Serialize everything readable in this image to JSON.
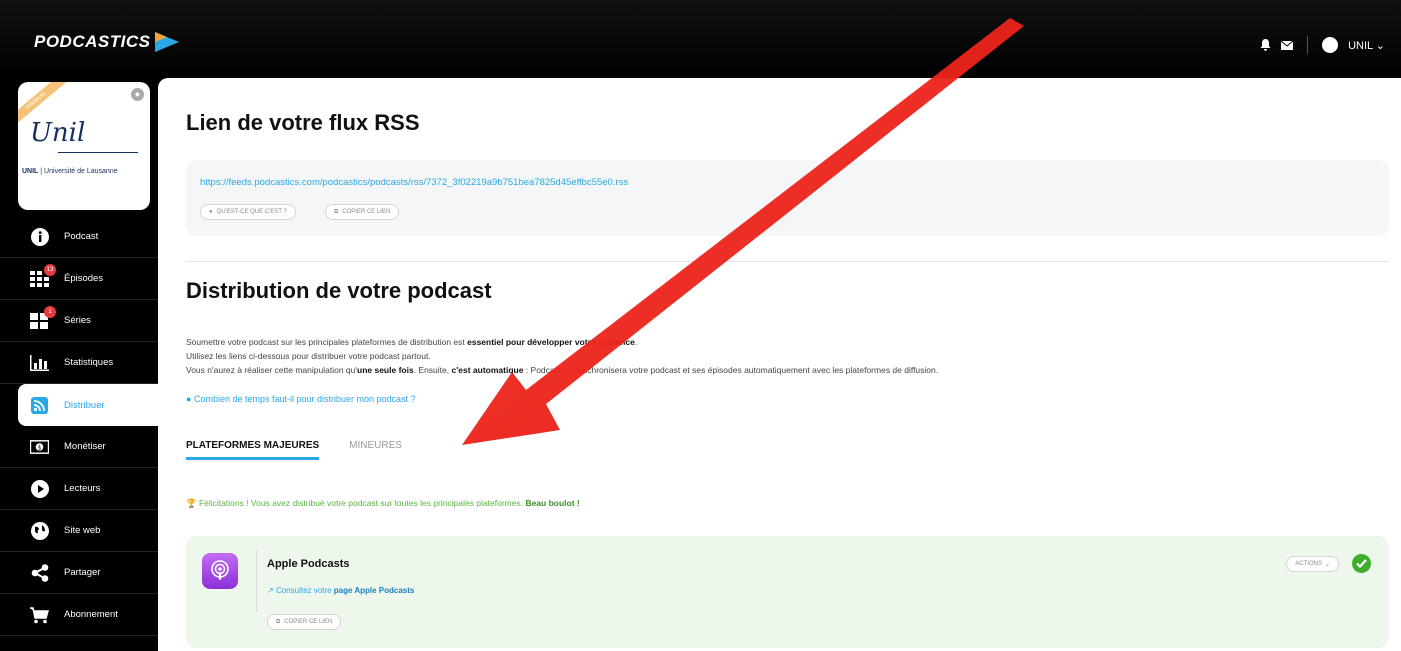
{
  "app": {
    "brand": "PODCASTICS",
    "user_label": "UNIL"
  },
  "profile": {
    "ribbon": "PREMIUM",
    "signature": "Unil",
    "org_prefix": "UNIL",
    "org_name": "| Université de Lausanne"
  },
  "sidebar": {
    "items": [
      {
        "label": "Podcast",
        "icon": "info-icon"
      },
      {
        "label": "Épisodes",
        "icon": "grid-icon",
        "badge": "13"
      },
      {
        "label": "Séries",
        "icon": "series-icon",
        "badge": "1"
      },
      {
        "label": "Statistiques",
        "icon": "stats-icon"
      },
      {
        "label": "Distribuer",
        "icon": "rss-icon",
        "active": true
      },
      {
        "label": "Monétiser",
        "icon": "money-icon"
      },
      {
        "label": "Lecteurs",
        "icon": "play-icon"
      },
      {
        "label": "Site web",
        "icon": "globe-icon"
      },
      {
        "label": "Partager",
        "icon": "share-icon"
      },
      {
        "label": "Abonnement",
        "icon": "cart-icon"
      }
    ]
  },
  "rss": {
    "title": "Lien de votre flux RSS",
    "url": "https://feeds.podcastics.com/podcastics/podcasts/rss/7372_3f02219a9b751bea7825d45effbc55e0.rss",
    "what_label": "QU'EST-CE QUE C'EST ?",
    "copy_label": "COPIER CE LIEN"
  },
  "distribution": {
    "title": "Distribution de votre podcast",
    "line1_a": "Soumettre votre podcast sur les principales plateformes de distribution est ",
    "line1_b": "essentiel pour développer votre audience",
    "line1_c": ".",
    "line2": "Utilisez les liens ci-dessous pour distribuer votre podcast partout.",
    "line3_a": "Vous n'aurez à réaliser cette manipulation qu'",
    "line3_b": "une seule fois",
    "line3_c": ". Ensuite, ",
    "line3_d": "c'est automatique",
    "line3_e": " : Podcastics synchronisera votre podcast et ses épisodes automatiquement avec les plateformes de diffusion.",
    "faq": "Combien de temps faut-il pour distribuer mon podcast ?"
  },
  "tabs": {
    "major": "PLATEFORMES MAJEURES",
    "minor": "MINEURES"
  },
  "congrats": {
    "text": "Félicitations ! Vous avez distribué votre podcast sur toutes les principales plateformes. ",
    "bold": "Beau boulot !"
  },
  "platform": {
    "name": "Apple Podcasts",
    "link_prefix": "Consultez votre ",
    "link_bold": "page Apple Podcasts",
    "copy_label": "COPIER CE LIEN",
    "actions_label": "ACTIONS"
  },
  "colors": {
    "accent": "#2aa8e6",
    "success": "#3fae2a",
    "annotation_arrow": "#e8150f"
  }
}
